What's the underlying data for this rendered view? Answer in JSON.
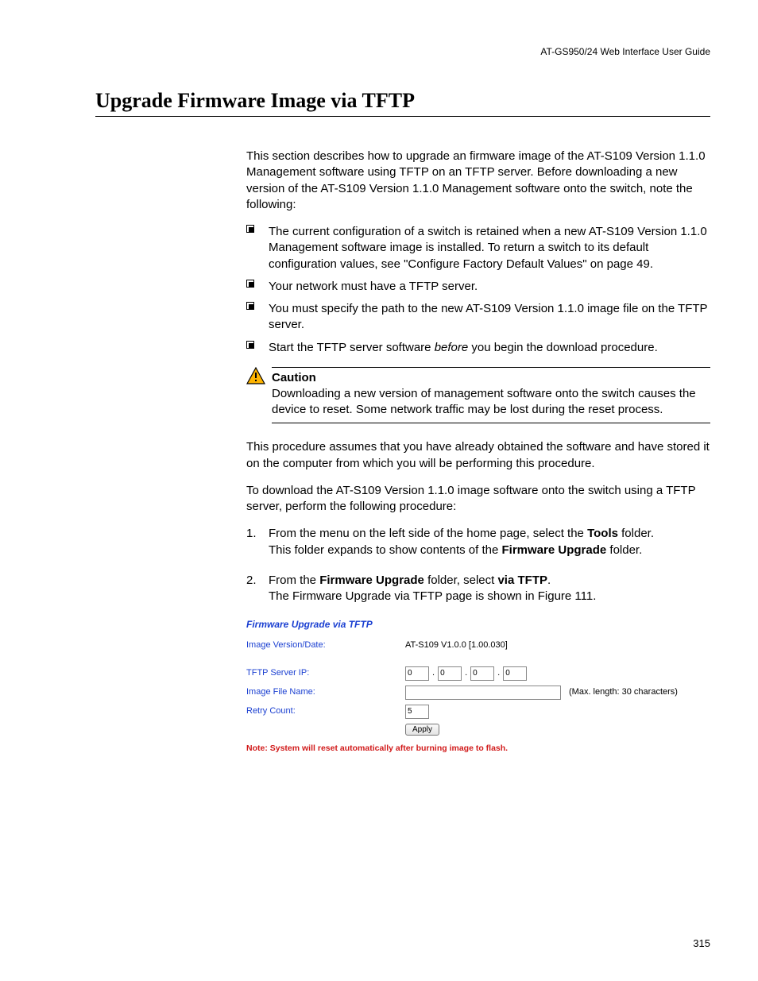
{
  "header": "AT-GS950/24  Web Interface User Guide",
  "title": "Upgrade Firmware Image via TFTP",
  "intro": "This section describes how to upgrade an firmware image of the AT-S109 Version 1.1.0  Management software using TFTP on an TFTP server. Before downloading a new version of the AT-S109 Version 1.1.0 Management software onto the switch, note the following:",
  "bullets": [
    "The current configuration of a switch is retained when a new AT-S109 Version 1.1.0  Management software image is installed. To return a switch to its default configuration values, see \"Configure Factory Default Values\" on page 49.",
    "Your network must have a TFTP server.",
    "You must specify the path to the new AT-S109 Version 1.1.0  image file on the TFTP server."
  ],
  "bullet4_pre": "Start the TFTP server software ",
  "bullet4_em": "before",
  "bullet4_post": " you begin the download procedure.",
  "caution_label": "Caution",
  "caution_text": "Downloading a new version of management software onto the switch causes the device to reset. Some network traffic may be lost during the reset process.",
  "assume": "This procedure assumes that you have already obtained the software and have stored it on the computer from which you will be performing this procedure.",
  "download_intro": "To download the AT-S109 Version 1.1.0  image software onto the switch using a TFTP server, perform the following procedure:",
  "step1": {
    "num": "1.",
    "pre": "From the menu on the left side of the home page, select the ",
    "bold": "Tools",
    "post": " folder.",
    "line2_pre": "This folder expands to show contents of the ",
    "line2_bold": "Firmware Upgrade",
    "line2_post": " folder."
  },
  "step2": {
    "num": "2.",
    "pre": "From the ",
    "bold1": "Firmware Upgrade",
    "mid": " folder, select ",
    "bold2": "via TFTP",
    "post": ".",
    "line2": "The Firmware Upgrade via TFTP page is shown in Figure 111."
  },
  "screenshot": {
    "title": "Firmware Upgrade via TFTP",
    "labels": {
      "version": "Image Version/Date:",
      "ip": "TFTP Server IP:",
      "file": "Image File Name:",
      "retry": "Retry Count:"
    },
    "version_value": "AT-S109 V1.0.0 [1.00.030]",
    "ip": [
      "0",
      "0",
      "0",
      "0"
    ],
    "file_value": "",
    "maxlen": "(Max. length: 30 characters)",
    "retry_value": "5",
    "apply": "Apply",
    "note": "Note: System will reset automatically after burning image to flash."
  },
  "page_num": "315"
}
